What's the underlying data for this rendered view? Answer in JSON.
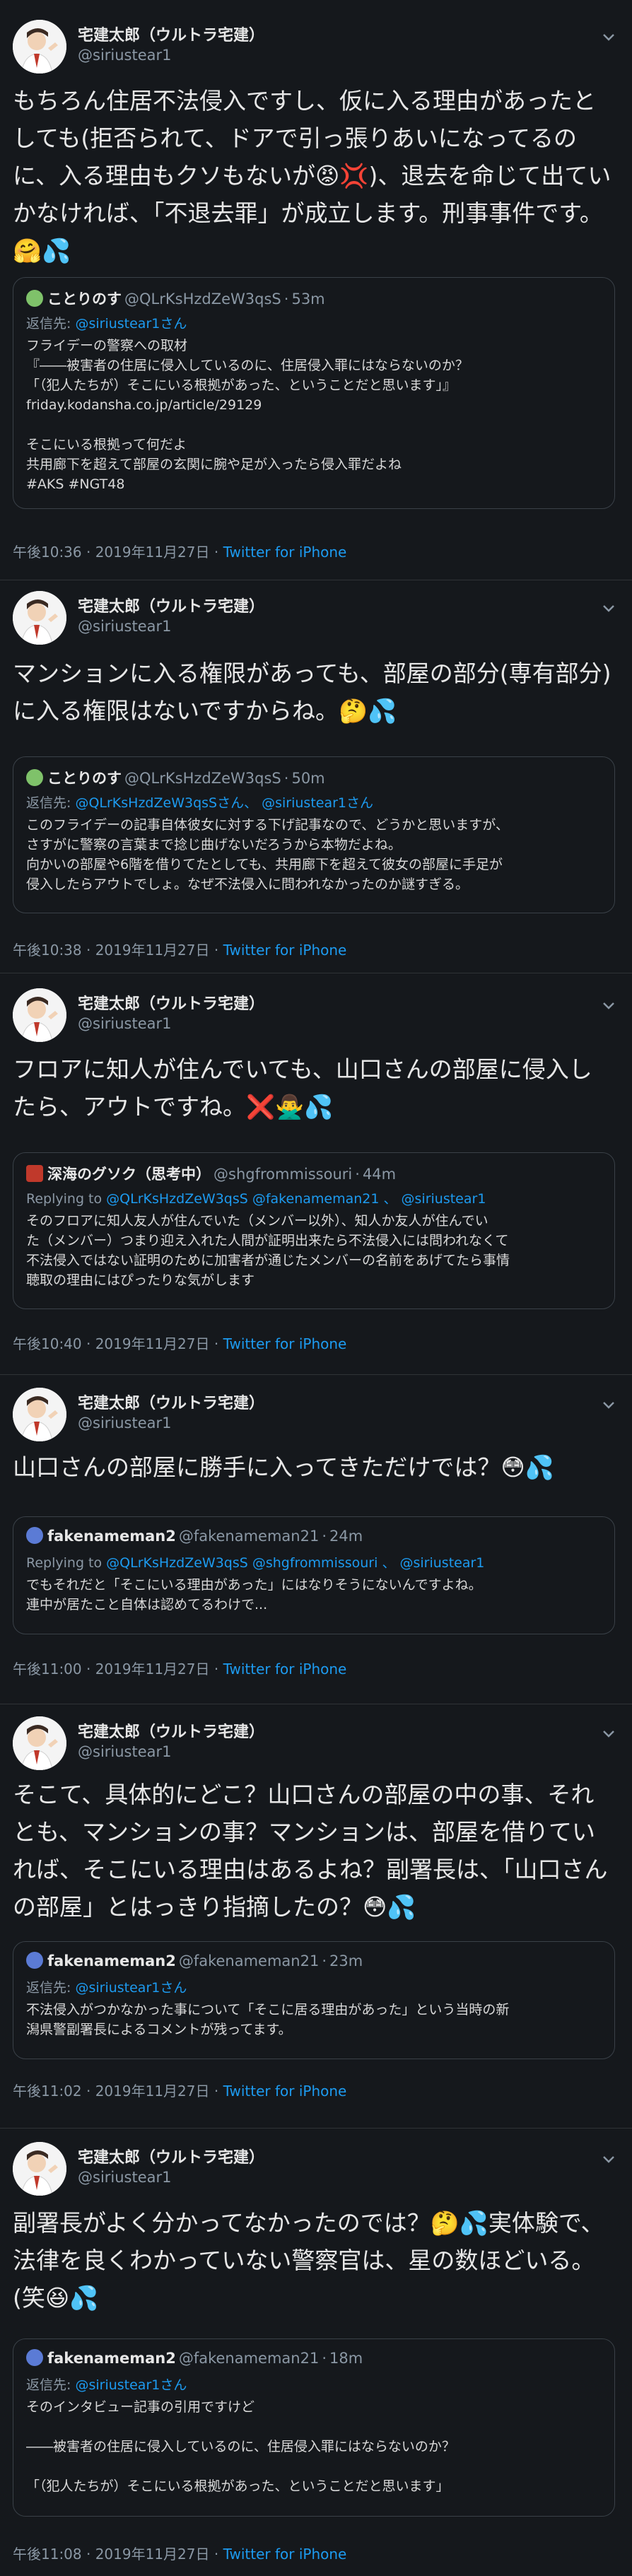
{
  "author": {
    "name": "宅建太郎（ウルトラ宅建）",
    "handle": "@siriustear1"
  },
  "colors": {
    "background": "#15181c",
    "link": "#1d9bf0",
    "muted": "#8b98a5"
  },
  "tweets": [
    {
      "text": "もちろん住居不法侵入ですし、仮に入る理由があったとしても(拒否られて、ドアで引っ張りあいになってるのに、入る理由もクソもないが😡💢)、退去を命じて出ていかなければ、「不退去罪」が成立します。刑事事件です。🤗💦",
      "quote": {
        "name": "ことりのす",
        "handle": "@QLrKsHzdZeW3qsS",
        "time": "53m",
        "reply_prefix": "返信先:",
        "reply_to": "@siriustear1さん",
        "text": "フライデーの警察への取材\n『――被害者の住居に侵入しているのに、住居侵入罪にはならないのか？\n「（犯人たちが）そこにいる根拠があった、ということだと思います」』\nfriday.kodansha.co.jp/article/29129\n\nそこにいる根拠って何だよ\n共用廊下を超えて部屋の玄関に腕や足が入ったら侵入罪だよね\n#AKS #NGT48"
      },
      "time": "午後10:36 · 2019年11月27日 ·",
      "source": "Twitter for iPhone"
    },
    {
      "text": "マンションに入る権限があっても、部屋の部分(専有部分)に入る権限はないですからね。🤔💦",
      "quote": {
        "name": "ことりのす",
        "handle": "@QLrKsHzdZeW3qsS",
        "time": "50m",
        "reply_prefix": "返信先:",
        "reply_to": "@QLrKsHzdZeW3qsSさん、 @siriustear1さん",
        "text": "このフライデーの記事自体彼女に対する下げ記事なので、どうかと思いますが、\nさすがに警察の言葉まで捻じ曲げないだろうから本物だよね。\n向かいの部屋や6階を借りてたとしても、共用廊下を超えて彼女の部屋に手足が\n侵入したらアウトでしょ。なぜ不法侵入に問われなかったのか謎すぎる。"
      },
      "time": "午後10:38 · 2019年11月27日 ·",
      "source": "Twitter for iPhone"
    },
    {
      "text": "フロアに知人が住んでいても、山口さんの部屋に侵入したら、アウトですね。❌🙅‍♂️💦",
      "quote": {
        "name": "深海のグソク（思考中）",
        "handle": "@shgfrommissouri",
        "time": "44m",
        "reply_prefix": "Replying to",
        "reply_to": "@QLrKsHzdZeW3qsS @fakenameman21 、 @siriustear1",
        "text": "そのフロアに知人友人が住んでいた（メンバー以外）、知人か友人が住んでい\nた（メンバー）つまり迎え入れた人間が証明出来たら不法侵入には問われなくて\n不法侵入ではない証明のために加害者が通じたメンバーの名前をあげてたら事情\n聴取の理由にはぴったりな気がします"
      },
      "time": "午後10:40 · 2019年11月27日 ·",
      "source": "Twitter for iPhone"
    },
    {
      "text": "山口さんの部屋に勝手に入ってきただけでは？😳💦",
      "quote": {
        "name": "fakenameman2",
        "handle": "@fakenameman21",
        "time": "24m",
        "reply_prefix": "Replying to",
        "reply_to": "@QLrKsHzdZeW3qsS @shgfrommissouri 、 @siriustear1",
        "text": "でもそれだと「そこにいる理由があった」にはなりそうにないんですよね。\n連中が居たこと自体は認めてるわけで..."
      },
      "time": "午後11:00 · 2019年11月27日 ·",
      "source": "Twitter for iPhone"
    },
    {
      "text": "そこて、具体的にどこ？山口さんの部屋の中の事、それとも、マンションの事？マンションは、部屋を借りていれば、そこにいる理由はあるよね？副署長は、「山口さんの部屋」とはっきり指摘したの？😳💦",
      "quote": {
        "name": "fakenameman2",
        "handle": "@fakenameman21",
        "time": "23m",
        "reply_prefix": "返信先:",
        "reply_to": "@siriustear1さん",
        "text": "不法侵入がつかなかった事について「そこに居る理由があった」という当時の新\n潟県警副署長によるコメントが残ってます。"
      },
      "time": "午後11:02 · 2019年11月27日 ·",
      "source": "Twitter for iPhone"
    },
    {
      "text": "副署長がよく分かってなかったのでは？🤔💦実体験で、法律を良くわかっていない警察官は、星の数ほどいる。(笑😆💦",
      "quote": {
        "name": "fakenameman2",
        "handle": "@fakenameman21",
        "time": "18m",
        "reply_prefix": "返信先:",
        "reply_to": "@siriustear1さん",
        "text": "そのインタビュー記事の引用ですけど\n\n――被害者の住居に侵入しているのに、住居侵入罪にはならないのか？\n\n「（犯人たちが）そこにいる根拠があった、ということだと思います」"
      },
      "time": "午後11:08 · 2019年11月27日 ·",
      "source": "Twitter for iPhone"
    }
  ]
}
